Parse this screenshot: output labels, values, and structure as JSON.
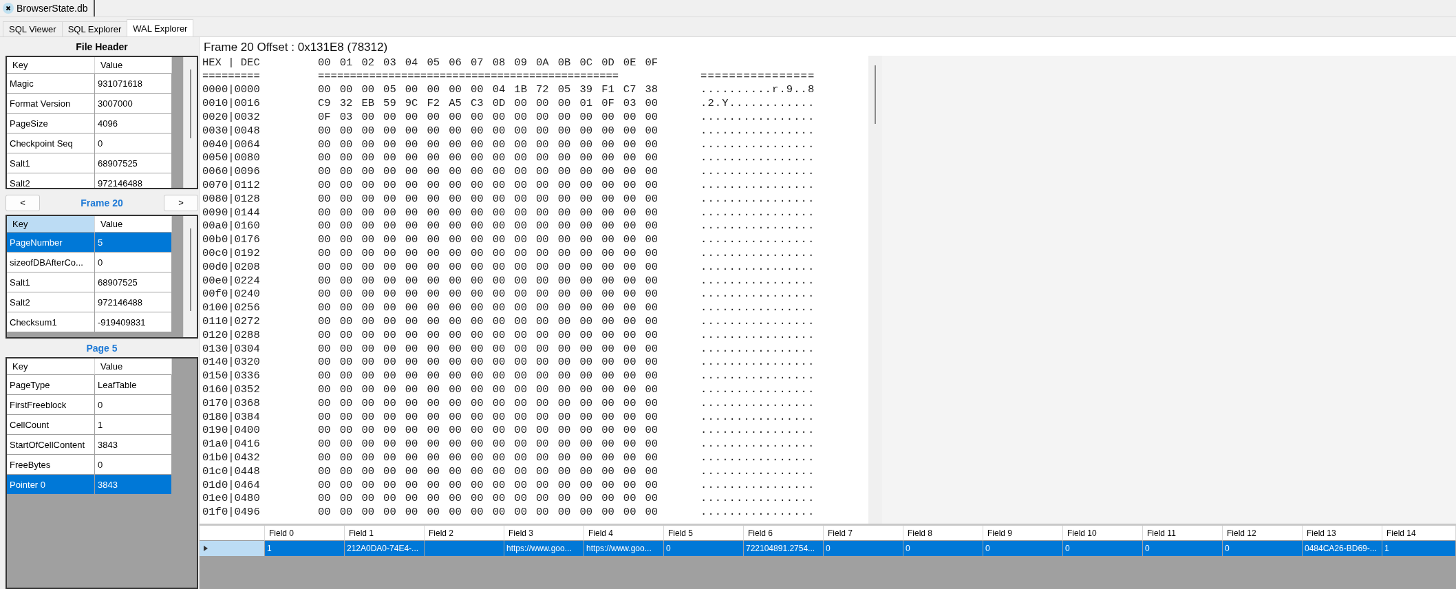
{
  "document_tabs": [
    {
      "label": "BrowserState.db",
      "selected": true
    }
  ],
  "tabs": [
    {
      "label": "SQL Viewer",
      "selected": false
    },
    {
      "label": "SQL Explorer",
      "selected": false
    },
    {
      "label": "WAL Explorer",
      "selected": true
    }
  ],
  "file_header": {
    "title": "File Header",
    "columns": [
      {
        "label": "Key",
        "selected": false
      },
      {
        "label": "Value",
        "selected": false
      }
    ],
    "rows": [
      {
        "key": "Magic",
        "value": "931071618",
        "selected": false
      },
      {
        "key": "Format Version",
        "value": "3007000",
        "selected": false
      },
      {
        "key": "PageSize",
        "value": "4096",
        "selected": false
      },
      {
        "key": "Checkpoint Seq",
        "value": "0",
        "selected": false
      },
      {
        "key": "Salt1",
        "value": "68907525",
        "selected": false
      },
      {
        "key": "Salt2",
        "value": "972146488",
        "selected": false
      }
    ]
  },
  "frame": {
    "prev": "<",
    "next": ">",
    "title": "Frame 20",
    "columns": [
      {
        "label": "Key",
        "selected": true
      },
      {
        "label": "Value",
        "selected": false
      }
    ],
    "rows": [
      {
        "key": "PageNumber",
        "value": "5",
        "selected": true
      },
      {
        "key": "sizeofDBAfterCo...",
        "value": "0",
        "selected": false
      },
      {
        "key": "Salt1",
        "value": "68907525",
        "selected": false
      },
      {
        "key": "Salt2",
        "value": "972146488",
        "selected": false
      },
      {
        "key": "Checksum1",
        "value": "-919409831",
        "selected": false
      }
    ]
  },
  "page": {
    "title": "Page 5",
    "columns": [
      {
        "label": "Key",
        "selected": false
      },
      {
        "label": "Value",
        "selected": false
      }
    ],
    "rows": [
      {
        "key": "PageType",
        "value": "LeafTable",
        "selected": false
      },
      {
        "key": "FirstFreeblock",
        "value": "0",
        "selected": false
      },
      {
        "key": "CellCount",
        "value": "1",
        "selected": false
      },
      {
        "key": "StartOfCellContent",
        "value": "3843",
        "selected": false
      },
      {
        "key": "FreeBytes",
        "value": "0",
        "selected": false
      },
      {
        "key": "Pointer 0",
        "value": "3843",
        "selected": true
      }
    ]
  },
  "hex_view": {
    "title": "Frame 20 Offset : 0x131E8 (78312)",
    "header": {
      "offset": "HEX | DEC",
      "bytes": "00 01 02 03 04 05 06 07 08 09 0A 0B 0C 0D 0E 0F"
    },
    "separator": {
      "offset": "=========",
      "bytes": "===============================================",
      "ascii": "================"
    },
    "rows": [
      {
        "offset": "0000|0000",
        "bytes": "00 00 00 05 00 00 00 00 04 1B 72 05 39 F1 C7 38",
        "ascii": "..........r.9..8"
      },
      {
        "offset": "0010|0016",
        "bytes": "C9 32 EB 59 9C F2 A5 C3 0D 00 00 00 01 0F 03 00",
        "ascii": ".2.Y............"
      },
      {
        "offset": "0020|0032",
        "bytes": "0F 03 00 00 00 00 00 00 00 00 00 00 00 00 00 00",
        "ascii": "................"
      },
      {
        "offset": "0030|0048",
        "bytes": "00 00 00 00 00 00 00 00 00 00 00 00 00 00 00 00",
        "ascii": "................"
      },
      {
        "offset": "0040|0064",
        "bytes": "00 00 00 00 00 00 00 00 00 00 00 00 00 00 00 00",
        "ascii": "................"
      },
      {
        "offset": "0050|0080",
        "bytes": "00 00 00 00 00 00 00 00 00 00 00 00 00 00 00 00",
        "ascii": "................"
      },
      {
        "offset": "0060|0096",
        "bytes": "00 00 00 00 00 00 00 00 00 00 00 00 00 00 00 00",
        "ascii": "................"
      },
      {
        "offset": "0070|0112",
        "bytes": "00 00 00 00 00 00 00 00 00 00 00 00 00 00 00 00",
        "ascii": "................"
      },
      {
        "offset": "0080|0128",
        "bytes": "00 00 00 00 00 00 00 00 00 00 00 00 00 00 00 00",
        "ascii": "................"
      },
      {
        "offset": "0090|0144",
        "bytes": "00 00 00 00 00 00 00 00 00 00 00 00 00 00 00 00",
        "ascii": "................"
      },
      {
        "offset": "00a0|0160",
        "bytes": "00 00 00 00 00 00 00 00 00 00 00 00 00 00 00 00",
        "ascii": "................"
      },
      {
        "offset": "00b0|0176",
        "bytes": "00 00 00 00 00 00 00 00 00 00 00 00 00 00 00 00",
        "ascii": "................"
      },
      {
        "offset": "00c0|0192",
        "bytes": "00 00 00 00 00 00 00 00 00 00 00 00 00 00 00 00",
        "ascii": "................"
      },
      {
        "offset": "00d0|0208",
        "bytes": "00 00 00 00 00 00 00 00 00 00 00 00 00 00 00 00",
        "ascii": "................"
      },
      {
        "offset": "00e0|0224",
        "bytes": "00 00 00 00 00 00 00 00 00 00 00 00 00 00 00 00",
        "ascii": "................"
      },
      {
        "offset": "00f0|0240",
        "bytes": "00 00 00 00 00 00 00 00 00 00 00 00 00 00 00 00",
        "ascii": "................"
      },
      {
        "offset": "0100|0256",
        "bytes": "00 00 00 00 00 00 00 00 00 00 00 00 00 00 00 00",
        "ascii": "................"
      },
      {
        "offset": "0110|0272",
        "bytes": "00 00 00 00 00 00 00 00 00 00 00 00 00 00 00 00",
        "ascii": "................"
      },
      {
        "offset": "0120|0288",
        "bytes": "00 00 00 00 00 00 00 00 00 00 00 00 00 00 00 00",
        "ascii": "................"
      },
      {
        "offset": "0130|0304",
        "bytes": "00 00 00 00 00 00 00 00 00 00 00 00 00 00 00 00",
        "ascii": "................"
      },
      {
        "offset": "0140|0320",
        "bytes": "00 00 00 00 00 00 00 00 00 00 00 00 00 00 00 00",
        "ascii": "................"
      },
      {
        "offset": "0150|0336",
        "bytes": "00 00 00 00 00 00 00 00 00 00 00 00 00 00 00 00",
        "ascii": "................"
      },
      {
        "offset": "0160|0352",
        "bytes": "00 00 00 00 00 00 00 00 00 00 00 00 00 00 00 00",
        "ascii": "................"
      },
      {
        "offset": "0170|0368",
        "bytes": "00 00 00 00 00 00 00 00 00 00 00 00 00 00 00 00",
        "ascii": "................"
      },
      {
        "offset": "0180|0384",
        "bytes": "00 00 00 00 00 00 00 00 00 00 00 00 00 00 00 00",
        "ascii": "................"
      },
      {
        "offset": "0190|0400",
        "bytes": "00 00 00 00 00 00 00 00 00 00 00 00 00 00 00 00",
        "ascii": "................"
      },
      {
        "offset": "01a0|0416",
        "bytes": "00 00 00 00 00 00 00 00 00 00 00 00 00 00 00 00",
        "ascii": "................"
      },
      {
        "offset": "01b0|0432",
        "bytes": "00 00 00 00 00 00 00 00 00 00 00 00 00 00 00 00",
        "ascii": "................"
      },
      {
        "offset": "01c0|0448",
        "bytes": "00 00 00 00 00 00 00 00 00 00 00 00 00 00 00 00",
        "ascii": "................"
      },
      {
        "offset": "01d0|0464",
        "bytes": "00 00 00 00 00 00 00 00 00 00 00 00 00 00 00 00",
        "ascii": "................"
      },
      {
        "offset": "01e0|0480",
        "bytes": "00 00 00 00 00 00 00 00 00 00 00 00 00 00 00 00",
        "ascii": "................"
      },
      {
        "offset": "01f0|0496",
        "bytes": "00 00 00 00 00 00 00 00 00 00 00 00 00 00 00 00",
        "ascii": "................"
      }
    ]
  },
  "records": {
    "columns": [
      "Field 0",
      "Field 1",
      "Field 2",
      "Field 3",
      "Field 4",
      "Field 5",
      "Field 6",
      "Field 7",
      "Field 8",
      "Field 9",
      "Field 10",
      "Field 11",
      "Field 12",
      "Field 13",
      "Field 14"
    ],
    "rows": [
      {
        "selected": true,
        "cells": [
          "1",
          "212A0DA0-74E4-...",
          null,
          "https://www.goo...",
          "https://www.goo...",
          "0",
          "722104891.2754...",
          "0",
          "0",
          "0",
          "0",
          "0",
          "0",
          "0484CA26-BD69-...",
          "1"
        ]
      }
    ]
  }
}
